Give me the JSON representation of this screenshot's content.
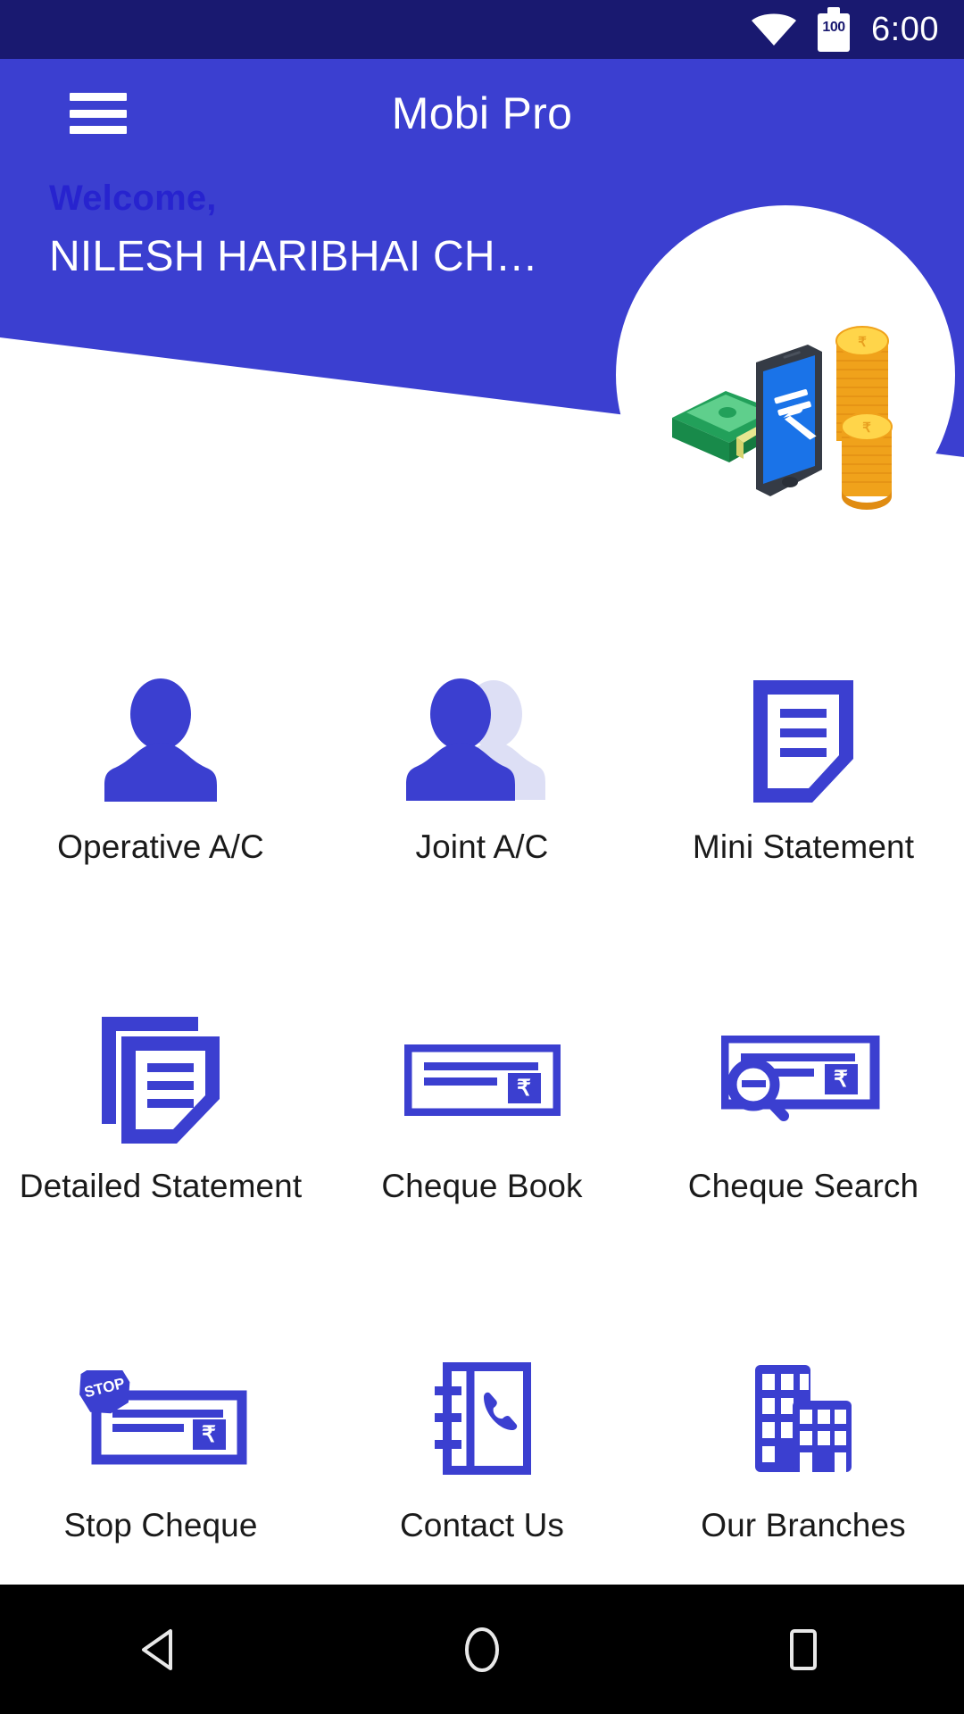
{
  "status_bar": {
    "wifi_icon": "wifi-icon",
    "battery_icon": "battery-icon",
    "battery_level": "100",
    "time": "6:00"
  },
  "app_bar": {
    "menu_icon": "hamburger-menu-icon",
    "title": "Mobi Pro"
  },
  "welcome": {
    "greeting": "Welcome,",
    "user_name": "NILESH HARIBHAI CH…"
  },
  "hero": {
    "illustration_name": "mobile-banking-money-illustration"
  },
  "menu": {
    "items": [
      {
        "label": "Operative A/C",
        "icon": "single-person-icon"
      },
      {
        "label": "Joint A/C",
        "icon": "two-persons-icon"
      },
      {
        "label": "Mini Statement",
        "icon": "document-icon"
      },
      {
        "label": "Detailed Statement",
        "icon": "stacked-documents-icon"
      },
      {
        "label": "Cheque Book",
        "icon": "cheque-icon"
      },
      {
        "label": "Cheque Search",
        "icon": "cheque-search-icon"
      },
      {
        "label": "Stop Cheque",
        "icon": "stop-cheque-icon"
      },
      {
        "label": "Contact Us",
        "icon": "phone-book-icon"
      },
      {
        "label": "Our Branches",
        "icon": "buildings-icon"
      }
    ]
  },
  "nav_bar": {
    "back_label": "back-icon",
    "home_label": "home-icon",
    "recents_label": "recents-icon"
  },
  "colors": {
    "status_bar_bg": "#191970",
    "header_blue": "#3b3fd0",
    "accent_blue": "#2723cf",
    "icon_blue": "#3b3fd0",
    "icon_blue_light": "#dddff5",
    "nav_bar_bg": "#000000",
    "page_bg": "#ffffff"
  }
}
